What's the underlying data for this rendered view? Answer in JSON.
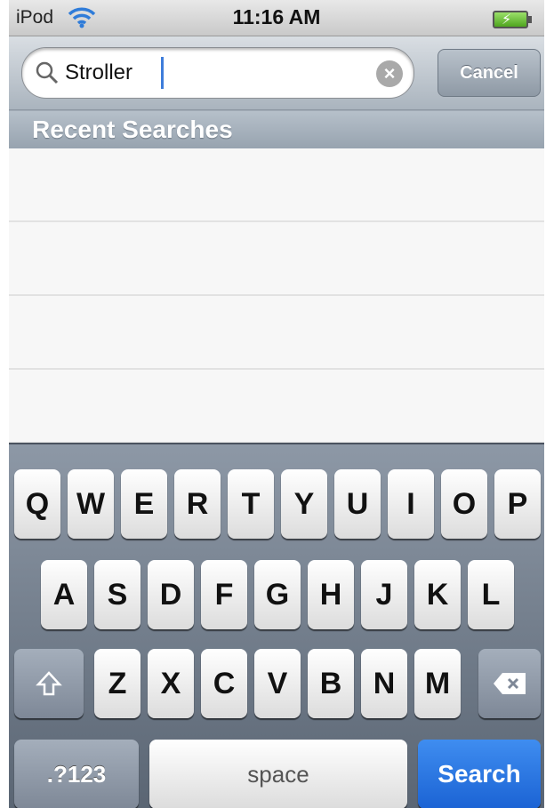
{
  "status_bar": {
    "carrier": "iPod",
    "time": "11:16 AM"
  },
  "search": {
    "value": "Stroller",
    "clear_icon": "clear-icon",
    "cancel_label": "Cancel"
  },
  "recent": {
    "header": "Recent Searches",
    "items": [
      "",
      "",
      "",
      ""
    ]
  },
  "keyboard": {
    "row1": [
      "Q",
      "W",
      "E",
      "R",
      "T",
      "Y",
      "U",
      "I",
      "O",
      "P"
    ],
    "row2": [
      "A",
      "S",
      "D",
      "F",
      "G",
      "H",
      "J",
      "K",
      "L"
    ],
    "row3": [
      "Z",
      "X",
      "C",
      "V",
      "B",
      "N",
      "M"
    ],
    "mode_label": ".?123",
    "space_label": "space",
    "search_label": "Search",
    "shift_icon": "shift-icon",
    "backspace_icon": "backspace-icon"
  }
}
